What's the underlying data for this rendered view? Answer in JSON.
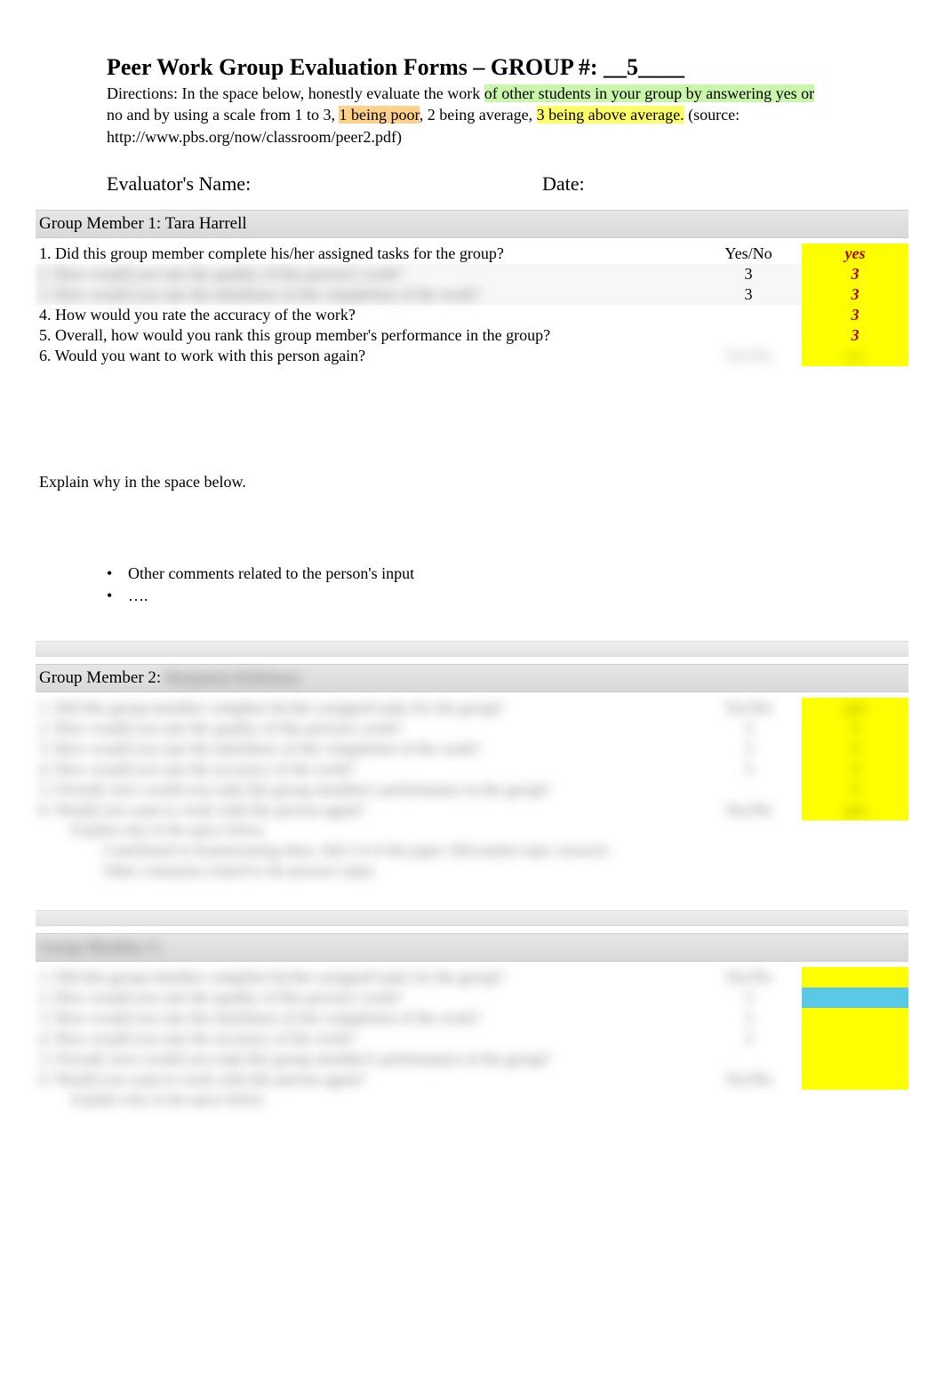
{
  "title_prefix": "Peer Work Group Evaluation Forms – GROUP #: __",
  "group_number": "5",
  "title_suffix": "____",
  "directions_lead": "Directions: In the space below, honestly evaluate the work ",
  "directions_hl1": "of other students in your group by answering yes or",
  "directions_mid1": " no and by using a scale from 1 to 3, ",
  "directions_poor": "1 being poor",
  "directions_mid2": ", 2 being average, ",
  "directions_above": "3 being above average.",
  "directions_source": "   (source: http://www.pbs.org/now/classroom/peer2.pdf)",
  "evaluator_label": "Evaluator's Name",
  "date_label": "Date:",
  "member1": {
    "label": "Group Member 1:  ",
    "name": "Tara Harrell",
    "questions": [
      {
        "q": "1. Did this group member complete his/her assigned tasks for the group?",
        "mid": "Yes/No",
        "ans": "yes",
        "ansStyle": "ans-cell"
      },
      {
        "q": "2. How would you rate the quality of this person's work?",
        "mid": "3",
        "ans": "3",
        "ansStyle": "ans-cell",
        "blur": true
      },
      {
        "q": "3. How would you rate the timeliness of the completion of the work?",
        "mid": "3",
        "ans": "3",
        "ansStyle": "ans-cell",
        "blur": true
      },
      {
        "q": "4. How would you rate the accuracy of the work?",
        "mid": "",
        "ans": "3",
        "ansStyle": "ans-cell"
      },
      {
        "q": "5. Overall, how would you rank this group member's performance in the group?",
        "mid": "",
        "ans": "3",
        "ansStyle": "ans-cell"
      },
      {
        "q": "6. Would you want to work with this person again?",
        "mid": "Yes/No",
        "ans": "yes",
        "ansStyle": "ans-cell-plain",
        "blurMid": true,
        "blurAns": true
      }
    ]
  },
  "explain_label": "Explain why in the space below.",
  "comments": {
    "line1": "Other comments related to the person's input",
    "line2": "…."
  },
  "member2": {
    "label": "Group Member 2:  ",
    "name_placeholder": "Benjamin Robinson",
    "questions": [
      {
        "q": "1. Did this group member complete his/her assigned tasks for the group?",
        "mid": "Yes/No",
        "ans": "yes"
      },
      {
        "q": "2. How would you rate the quality of this person's work?",
        "mid": "3",
        "ans": "3"
      },
      {
        "q": "3. How would you rate the timeliness of the completion of the work?",
        "mid": "3",
        "ans": "3"
      },
      {
        "q": "4. How would you rate the accuracy of the work?",
        "mid": "3",
        "ans": "3"
      },
      {
        "q": "5. Overall, how would you rank this group member's performance in the group?",
        "mid": "",
        "ans": "3"
      },
      {
        "q": "6. Would you want to work with this person again?",
        "mid": "Yes/No",
        "ans": "yes"
      }
    ],
    "explain": "Explain why in the space below.",
    "sub1": "Contributed to brainstorming ideas. Did 1/4 of the paper. Did market topic research.",
    "sub2": "Other comments related to the person's input"
  },
  "member3": {
    "label": "Group Member 3:",
    "questions": [
      {
        "q": "1. Did this group member complete his/her assigned tasks for the group?",
        "mid": "Yes/No",
        "ans": " ",
        "ansStyle": "ans-cell-plain"
      },
      {
        "q": "2. How would you rate the quality of this person's work?",
        "mid": "3",
        "ans": " ",
        "ansStyle": "cyan-cell"
      },
      {
        "q": "3. How would you rate the timeliness of the completion of the work?",
        "mid": "3",
        "ans": " ",
        "ansStyle": "ans-cell-plain"
      },
      {
        "q": "4. How would you rate the accuracy of the work?",
        "mid": "3",
        "ans": " ",
        "ansStyle": "ans-cell-plain"
      },
      {
        "q": "5. Overall, how would you rank this group member's performance in the group?",
        "mid": "",
        "ans": " ",
        "ansStyle": "ans-cell-plain"
      },
      {
        "q": "6. Would you want to work with this person again?",
        "mid": "Yes/No",
        "ans": " ",
        "ansStyle": "ans-cell-plain"
      }
    ],
    "explain": "Explain why in the space below."
  }
}
